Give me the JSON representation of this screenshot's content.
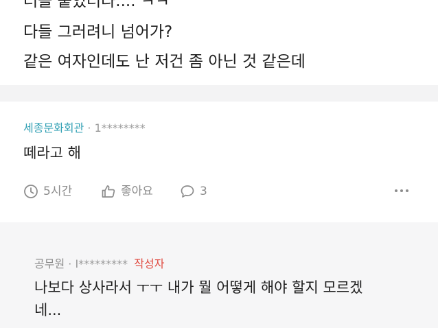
{
  "post": {
    "lines": [
      "터들 붙었더라.... ㅋㅋ",
      "다들 그러려니 넘어가?",
      "같은 여자인데도 난 저건 좀 아닌 것 같은데"
    ]
  },
  "comment": {
    "department": "세종문화회관",
    "separator": "·",
    "user": "1********",
    "text": "떼라고 해",
    "time": "5시간",
    "like_label": "좋아요",
    "reply_count": "3"
  },
  "reply": {
    "department": "공무원",
    "separator": "·",
    "user": "I*********",
    "author_tag": "작성자",
    "text_lines": [
      "나보다 상사라서 ㅜㅜ 내가 뭘 어떻게 해야 할지 모르겠",
      "네..."
    ]
  },
  "colors": {
    "department": "#2f9fb3",
    "author_tag": "#e0493f",
    "muted": "#8c8c8c",
    "band": "#f3f3f4"
  },
  "icons": {
    "time": "clock-icon",
    "like": "thumbs-up-icon",
    "reply": "comment-bubble-icon",
    "more": "more-dots-icon"
  }
}
